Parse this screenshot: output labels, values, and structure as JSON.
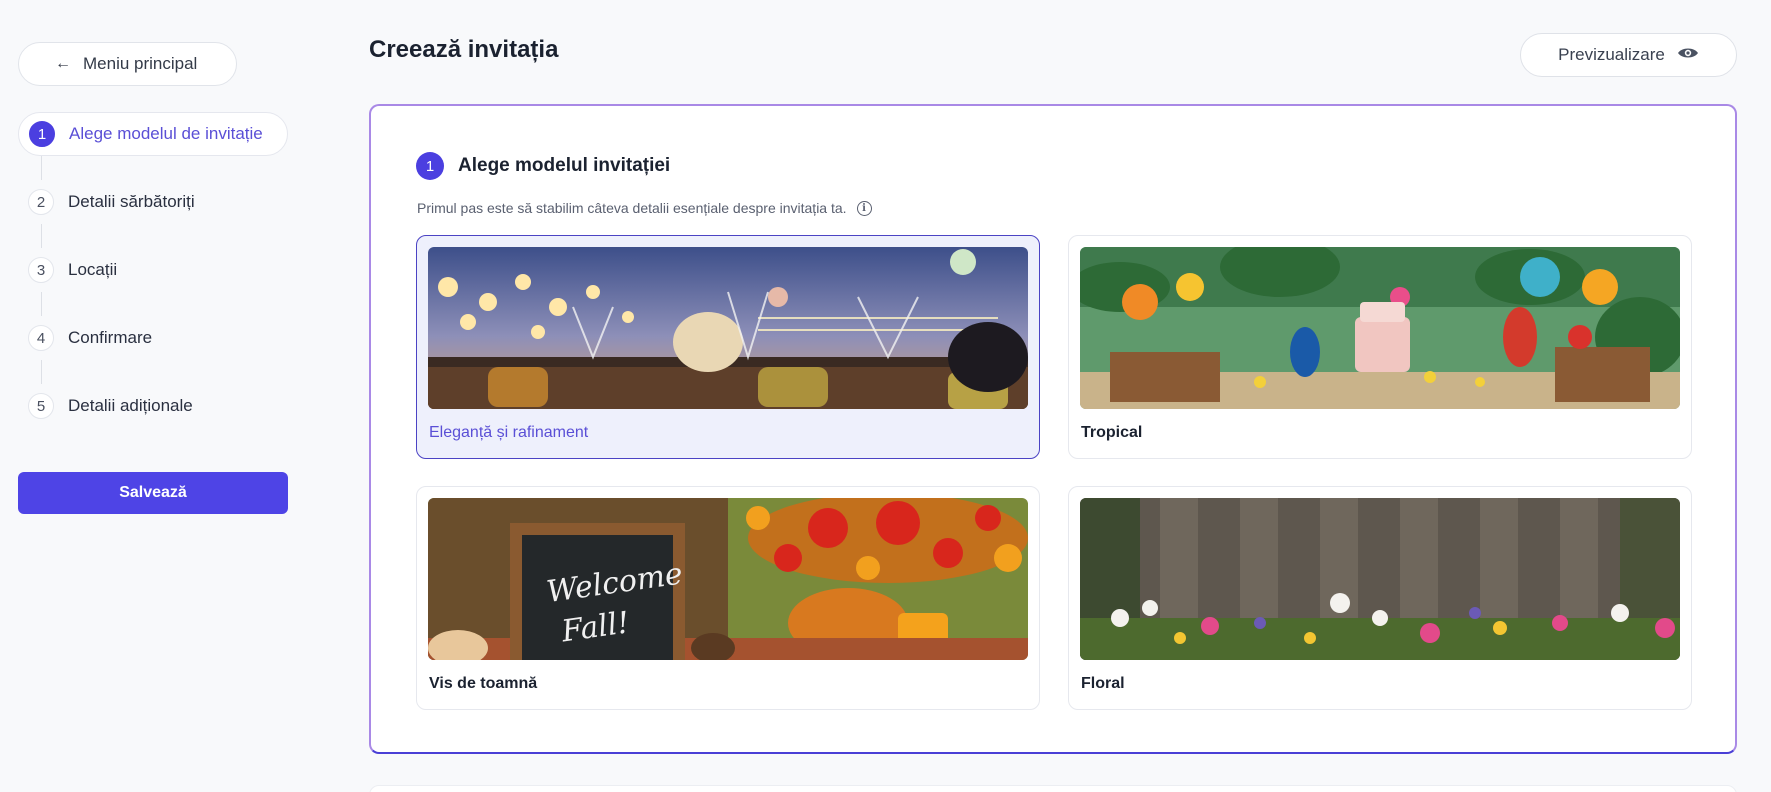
{
  "sidebar": {
    "back_label": "Meniu principal",
    "steps": [
      {
        "num": "1",
        "label": "Alege modelul de invitație",
        "active": true
      },
      {
        "num": "2",
        "label": "Detalii sărbătoriți"
      },
      {
        "num": "3",
        "label": "Locații"
      },
      {
        "num": "4",
        "label": "Confirmare"
      },
      {
        "num": "5",
        "label": "Detalii adiționale"
      }
    ],
    "save_label": "Salvează"
  },
  "header": {
    "title": "Creează invitația",
    "preview_label": "Previzualizare"
  },
  "card": {
    "step_num": "1",
    "title": "Alege modelul invitației",
    "description": "Primul pas este să stabilim câteva detalii esențiale despre invitația ta.",
    "templates": [
      {
        "label": "Eleganță și rafinament",
        "selected": true
      },
      {
        "label": "Tropical"
      },
      {
        "label": "Vis de toamnă"
      },
      {
        "label": "Floral"
      }
    ]
  },
  "colors": {
    "accent": "#4e44e6",
    "card_border": "#a989e6",
    "selected_bg": "#eef0fc"
  }
}
